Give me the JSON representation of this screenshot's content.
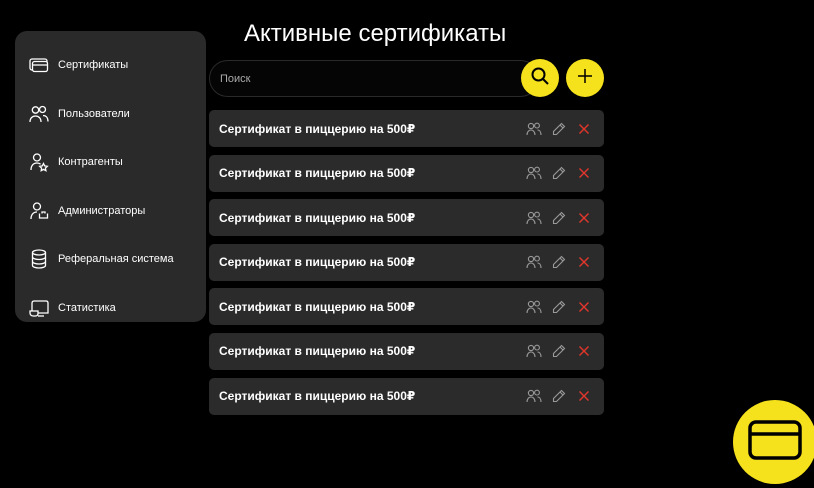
{
  "page": {
    "title": "Активные сертификаты"
  },
  "sidebar": {
    "items": [
      {
        "label": "Сертификаты",
        "icon": "certificate-icon"
      },
      {
        "label": "Пользователи",
        "icon": "users-icon"
      },
      {
        "label": "Контрагенты",
        "icon": "partner-icon"
      },
      {
        "label": "Администраторы",
        "icon": "admin-icon"
      },
      {
        "label": "Реферальная система",
        "icon": "database-icon"
      },
      {
        "label": "Статистика",
        "icon": "statistics-icon"
      }
    ]
  },
  "search": {
    "placeholder": "Поиск",
    "value": ""
  },
  "certificates": [
    {
      "title": "Сертификат в пиццерию на 500₽"
    },
    {
      "title": "Сертификат в пиццерию на 500₽"
    },
    {
      "title": "Сертификат в пиццерию на 500₽"
    },
    {
      "title": "Сертификат в пиццерию на 500₽"
    },
    {
      "title": "Сертификат в пиццерию на 500₽"
    },
    {
      "title": "Сертификат в пиццерию на 500₽"
    },
    {
      "title": "Сертификат в пиццерию на 500₽"
    }
  ],
  "colors": {
    "accent": "#f5e11c",
    "delete": "#e0372c",
    "panel": "#2a2a2a",
    "background": "#000000"
  }
}
